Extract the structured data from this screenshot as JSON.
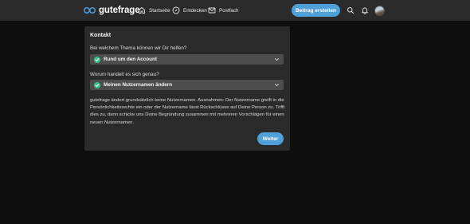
{
  "header": {
    "logo_text": "gutefrage",
    "nav": {
      "home": "Startseite",
      "explore": "Entdecken",
      "inbox": "Postfach"
    },
    "cta_label": "Beitrag erstellen",
    "icons": [
      "logo-icon",
      "home-icon",
      "compass-icon",
      "mail-icon",
      "search-icon",
      "bell-icon",
      "avatar"
    ]
  },
  "contact": {
    "title": "Kontakt",
    "q1_label": "Bei welchem Thema können wir Dir helfen?",
    "q1_value": "Rund um den Account",
    "q2_label": "Worum handelt es sich genau?",
    "q2_value": "Meinen Nutzernamen ändern",
    "info": "gutefrage ändert grundsätzlich keine Nutzernamen. Ausnahmen: Der Nutzername greift in die Persönlichkeitsrechte ein oder der Nutzername lässt Rückschlüsse auf Deine Person zu. Trifft dies zu, dann schicke uns Deine Begründung zusammen mit mehreren Vorschlägen für einen neuen Nutzernamen.",
    "next_label": "Weiter"
  },
  "colors": {
    "background": "#0d0d0d",
    "topbar": "#2a2a2a",
    "card": "#2a2a2a",
    "select": "#4d4d4d",
    "accent": "#4f9fd9",
    "check": "#3ebf8f"
  }
}
